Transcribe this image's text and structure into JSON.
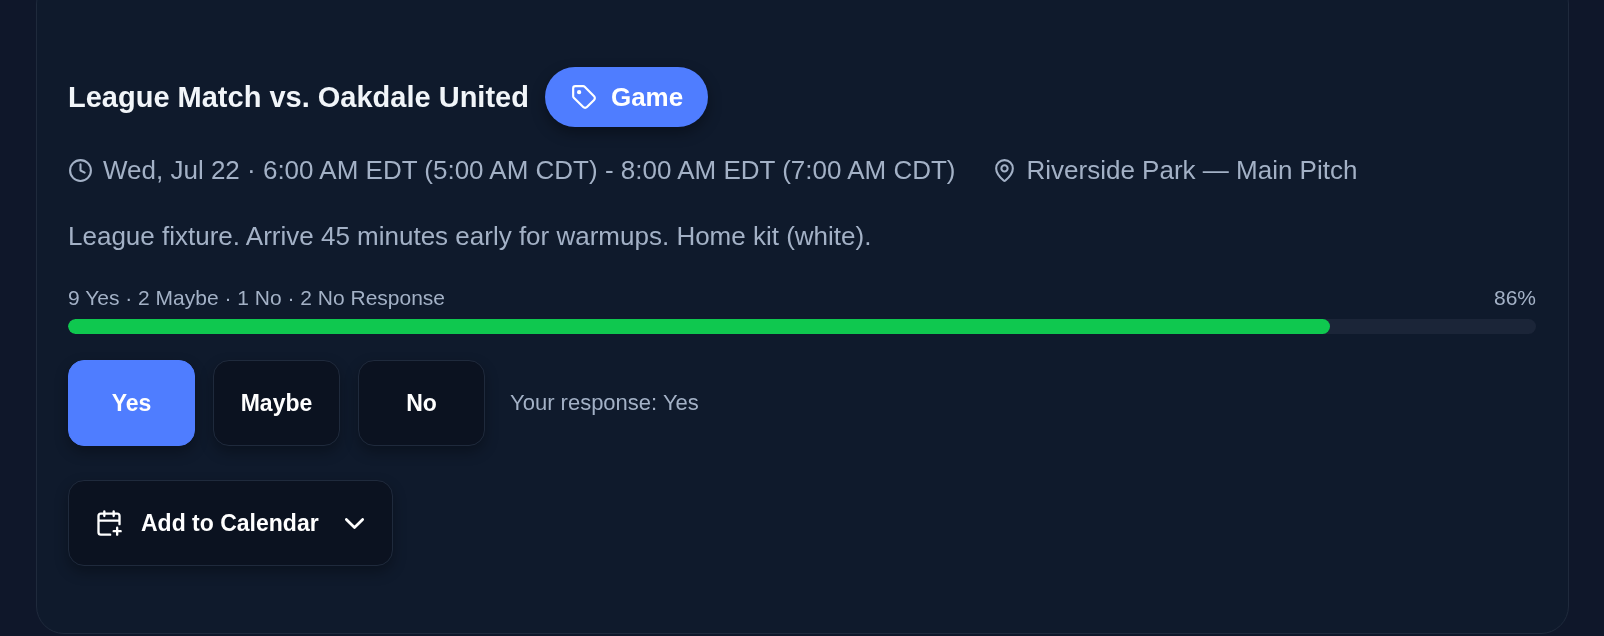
{
  "event": {
    "title": "League Match vs. Oakdale United",
    "tag": {
      "kind": "game",
      "label": "Game"
    },
    "time": "Wed, Jul 22 · 6:00 AM EDT (5:00 AM CDT) - 8:00 AM EDT (7:00 AM CDT)",
    "location": "Riverside Park — Main Pitch",
    "description": "League fixture. Arrive 45 minutes early for warmups. Home kit (white).",
    "attendance": {
      "summary": "9 Yes · 2 Maybe · 1 No · 2 No Response",
      "percent": "86%",
      "level": 0.86
    },
    "responses": [
      {
        "label": "Yes",
        "selected": true
      },
      {
        "label": "Maybe",
        "selected": false
      },
      {
        "label": "No",
        "selected": false
      }
    ],
    "your_response": "Your response: Yes",
    "calendar_button": {
      "label": "Add to Calendar"
    }
  }
}
